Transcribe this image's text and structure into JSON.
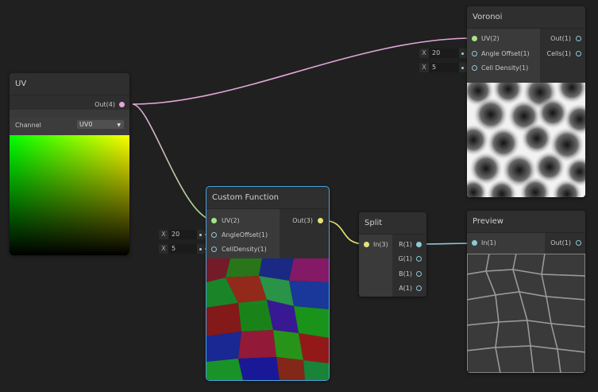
{
  "nodes": {
    "voronoi": {
      "title": "Voronoi",
      "inputs": [
        "UV(2)",
        "Angle Offset(1)",
        "Cell Density(1)"
      ],
      "outputs": [
        "Out(1)",
        "Cells(1)"
      ],
      "fields": [
        {
          "axis": "X",
          "value": "20"
        },
        {
          "axis": "X",
          "value": "5"
        }
      ]
    },
    "uv": {
      "title": "UV",
      "outputs": [
        "Out(4)"
      ],
      "channel_label": "Channel",
      "channel_value": "UV0"
    },
    "custom_function": {
      "title": "Custom Function",
      "inputs": [
        "UV(2)",
        "AngleOffset(1)",
        "CellDensity(1)"
      ],
      "outputs": [
        "Out(3)"
      ],
      "fields": [
        {
          "axis": "X",
          "value": "20"
        },
        {
          "axis": "X",
          "value": "5"
        }
      ]
    },
    "split": {
      "title": "Split",
      "inputs": [
        "In(3)"
      ],
      "outputs": [
        "R(1)",
        "G(1)",
        "B(1)",
        "A(1)"
      ]
    },
    "preview": {
      "title": "Preview",
      "inputs": [
        "In(1)"
      ],
      "outputs": [
        "Out(1)"
      ]
    }
  },
  "colors": {
    "background": "#202020",
    "node_body": "#393939",
    "node_header": "#2f2f2f",
    "selection_outline": "#4aa3df",
    "port_float": "#8ec9d6",
    "port_vector2": "#a8e38a",
    "port_vector3": "#e6e27a",
    "port_vector4": "#e2a7d8"
  }
}
